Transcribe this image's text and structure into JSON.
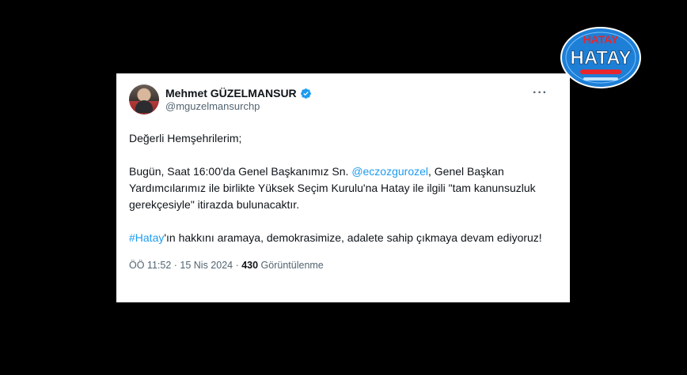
{
  "tweet": {
    "display_name": "Mehmet GÜZELMANSUR",
    "handle": "@mguzelmansurchp",
    "more_label": "···",
    "greeting": "Değerli Hemşehrilerim;",
    "para1_start": "Bugün, Saat 16:00'da Genel Başkanımız Sn. ",
    "mention": "@eczozgurozel",
    "para1_end": ", Genel Başkan Yardımcılarımız ile birlikte Yüksek Seçim Kurulu'na Hatay ile ilgili \"tam kanunsuzluk gerekçesiyle\" itirazda bulunacaktır.",
    "hashtag": "#Hatay",
    "para2_end": "'ın hakkını aramaya, demokrasimize, adalete sahip çıkmaya devam ediyoruz!",
    "time": "ÖÖ 11:52",
    "separator1": " · ",
    "date": "15 Nis 2024",
    "separator2": " · ",
    "views_count": "430",
    "views_label": " Görüntülenme"
  },
  "logo": {
    "text": "HATAY",
    "colors": {
      "primary": "#1e7fd6",
      "accent": "#e8262d"
    }
  },
  "icons": {
    "verified": "verified-badge-icon",
    "more": "more-options-icon"
  },
  "colors": {
    "background": "#000000",
    "card": "#ffffff",
    "link": "#1d9bf0",
    "text": "#0f1419",
    "muted": "#536471"
  }
}
